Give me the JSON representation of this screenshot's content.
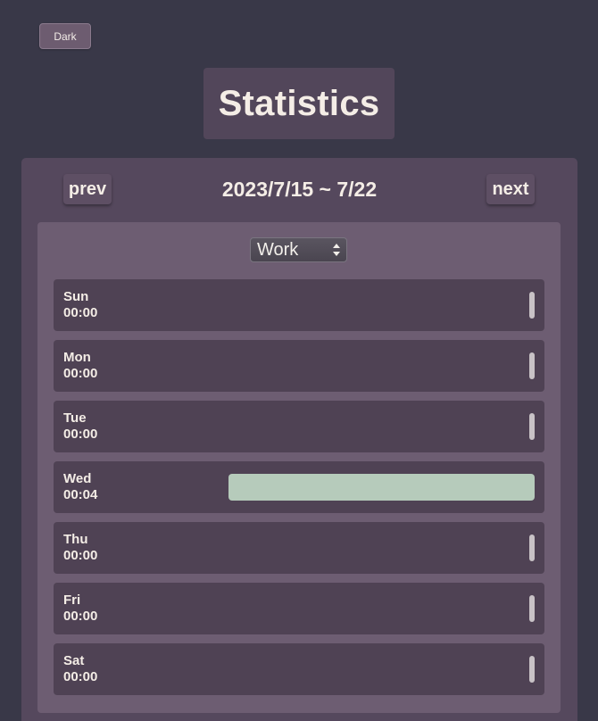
{
  "header": {
    "theme_button_label": "Dark",
    "title": "Statistics"
  },
  "nav": {
    "prev_label": "prev",
    "next_label": "next",
    "date_range": "2023/7/15 ~ 7/22"
  },
  "filter": {
    "selected": "Work"
  },
  "days": [
    {
      "day": "Sun",
      "time": "00:00",
      "fraction": 0
    },
    {
      "day": "Mon",
      "time": "00:00",
      "fraction": 0
    },
    {
      "day": "Tue",
      "time": "00:00",
      "fraction": 0
    },
    {
      "day": "Wed",
      "time": "00:04",
      "fraction": 1
    },
    {
      "day": "Thu",
      "time": "00:00",
      "fraction": 0
    },
    {
      "day": "Fri",
      "time": "00:00",
      "fraction": 0
    },
    {
      "day": "Sat",
      "time": "00:00",
      "fraction": 0
    }
  ],
  "colors": {
    "background": "#393848",
    "bar_fill": "#b6cbbb",
    "zero_marker": "#c8c2c6"
  }
}
